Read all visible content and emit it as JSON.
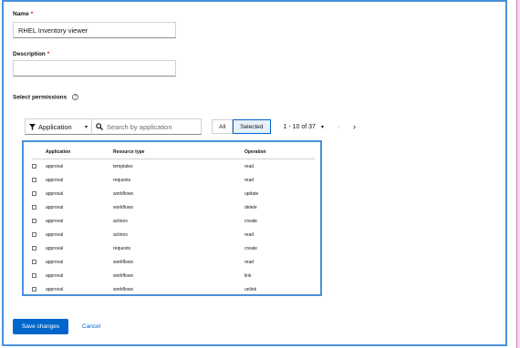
{
  "form": {
    "name_label": "Name",
    "name_required": "*",
    "name_value": "RHEL Inventory viewer",
    "description_label": "Description",
    "description_required": "*",
    "description_value": "",
    "permissions_label": "Select permissions",
    "help_icon": "?"
  },
  "toolbar": {
    "filter_icon": "filter-icon",
    "filter_label": "Application",
    "filter_caret": "▾",
    "search_icon": "search-icon",
    "search_placeholder": "Search by application",
    "toggle_all": "All",
    "toggle_selected": "Selected",
    "selected_active": true,
    "pagination_text": "1 - 10 of 37",
    "pagination_caret": "▾",
    "prev": "‹",
    "next": "›"
  },
  "table": {
    "headers": {
      "application": "Application",
      "resource_type": "Resource type",
      "operation": "Operation"
    },
    "rows": [
      {
        "application": "approval",
        "resource_type": "templates",
        "operation": "read"
      },
      {
        "application": "approval",
        "resource_type": "requests",
        "operation": "read"
      },
      {
        "application": "approval",
        "resource_type": "workflows",
        "operation": "update"
      },
      {
        "application": "approval",
        "resource_type": "workflows",
        "operation": "delete"
      },
      {
        "application": "approval",
        "resource_type": "actions",
        "operation": "create"
      },
      {
        "application": "approval",
        "resource_type": "actions",
        "operation": "read"
      },
      {
        "application": "approval",
        "resource_type": "requests",
        "operation": "create"
      },
      {
        "application": "approval",
        "resource_type": "workflows",
        "operation": "read"
      },
      {
        "application": "approval",
        "resource_type": "workflows",
        "operation": "link"
      },
      {
        "application": "approval",
        "resource_type": "workflows",
        "operation": "unlink"
      }
    ]
  },
  "actions": {
    "save_label": "Save changes",
    "cancel_label": "Cancel"
  },
  "colors": {
    "primary": "#0066cc",
    "highlight_border": "#4a90d9",
    "required": "#c9190b"
  }
}
